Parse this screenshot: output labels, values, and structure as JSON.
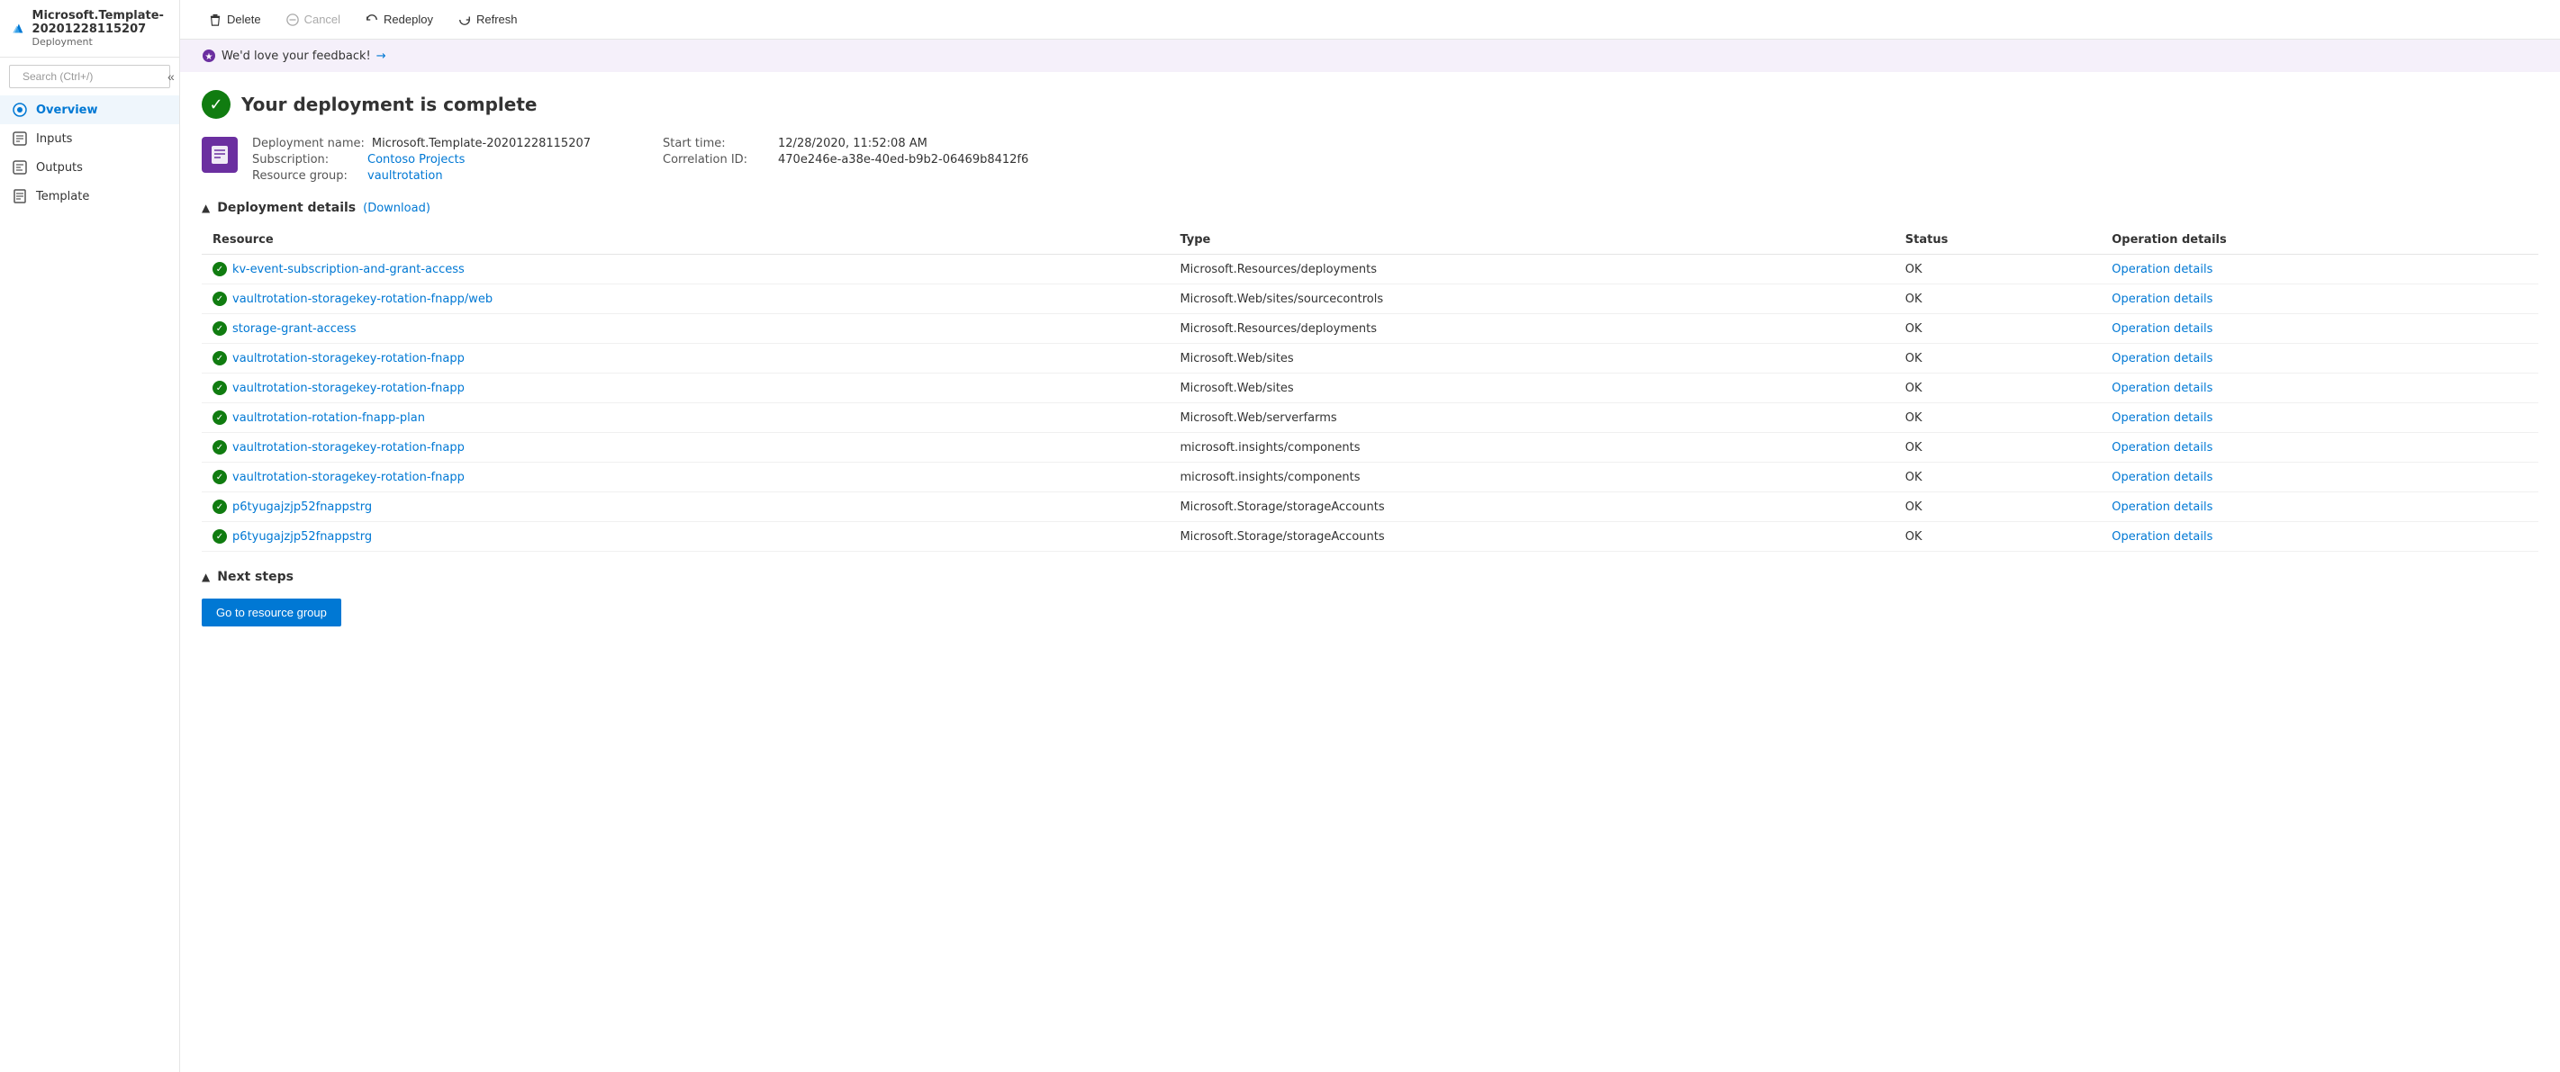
{
  "sidebar": {
    "title": "Microsoft.Template-20201228115207",
    "subtitle": "Deployment",
    "search_placeholder": "Search (Ctrl+/)",
    "collapse_label": "«",
    "nav_items": [
      {
        "id": "overview",
        "label": "Overview",
        "active": true,
        "icon": "overview-icon"
      },
      {
        "id": "inputs",
        "label": "Inputs",
        "active": false,
        "icon": "inputs-icon"
      },
      {
        "id": "outputs",
        "label": "Outputs",
        "active": false,
        "icon": "outputs-icon"
      },
      {
        "id": "template",
        "label": "Template",
        "active": false,
        "icon": "template-icon"
      }
    ]
  },
  "toolbar": {
    "delete_label": "Delete",
    "cancel_label": "Cancel",
    "redeploy_label": "Redeploy",
    "refresh_label": "Refresh"
  },
  "feedback": {
    "text": "We'd love your feedback!",
    "arrow": "→"
  },
  "deployment": {
    "complete_title": "Your deployment is complete",
    "meta": {
      "name_label": "Deployment name:",
      "name_value": "Microsoft.Template-20201228115207",
      "subscription_label": "Subscription:",
      "subscription_value": "Contoso Projects",
      "resource_group_label": "Resource group:",
      "resource_group_value": "vaultrotation",
      "start_time_label": "Start time:",
      "start_time_value": "12/28/2020, 11:52:08 AM",
      "correlation_label": "Correlation ID:",
      "correlation_value": "470e246e-a38e-40ed-b9b2-06469b8412f6"
    },
    "details_section": "Deployment details",
    "download_label": "(Download)",
    "table": {
      "headers": [
        "Resource",
        "Type",
        "Status",
        "Operation details"
      ],
      "rows": [
        {
          "resource": "kv-event-subscription-and-grant-access",
          "type": "Microsoft.Resources/deployments",
          "status": "OK",
          "operation": "Operation details"
        },
        {
          "resource": "vaultrotation-storagekey-rotation-fnapp/web",
          "type": "Microsoft.Web/sites/sourcecontrols",
          "status": "OK",
          "operation": "Operation details"
        },
        {
          "resource": "storage-grant-access",
          "type": "Microsoft.Resources/deployments",
          "status": "OK",
          "operation": "Operation details"
        },
        {
          "resource": "vaultrotation-storagekey-rotation-fnapp",
          "type": "Microsoft.Web/sites",
          "status": "OK",
          "operation": "Operation details"
        },
        {
          "resource": "vaultrotation-storagekey-rotation-fnapp",
          "type": "Microsoft.Web/sites",
          "status": "OK",
          "operation": "Operation details"
        },
        {
          "resource": "vaultrotation-rotation-fnapp-plan",
          "type": "Microsoft.Web/serverfarms",
          "status": "OK",
          "operation": "Operation details"
        },
        {
          "resource": "vaultrotation-storagekey-rotation-fnapp",
          "type": "microsoft.insights/components",
          "status": "OK",
          "operation": "Operation details"
        },
        {
          "resource": "vaultrotation-storagekey-rotation-fnapp",
          "type": "microsoft.insights/components",
          "status": "OK",
          "operation": "Operation details"
        },
        {
          "resource": "p6tyugajzjp52fnappstrg",
          "type": "Microsoft.Storage/storageAccounts",
          "status": "OK",
          "operation": "Operation details"
        },
        {
          "resource": "p6tyugajzjp52fnappstrg",
          "type": "Microsoft.Storage/storageAccounts",
          "status": "OK",
          "operation": "Operation details"
        }
      ]
    },
    "next_steps_label": "Next steps",
    "go_to_resource_group_label": "Go to resource group"
  }
}
